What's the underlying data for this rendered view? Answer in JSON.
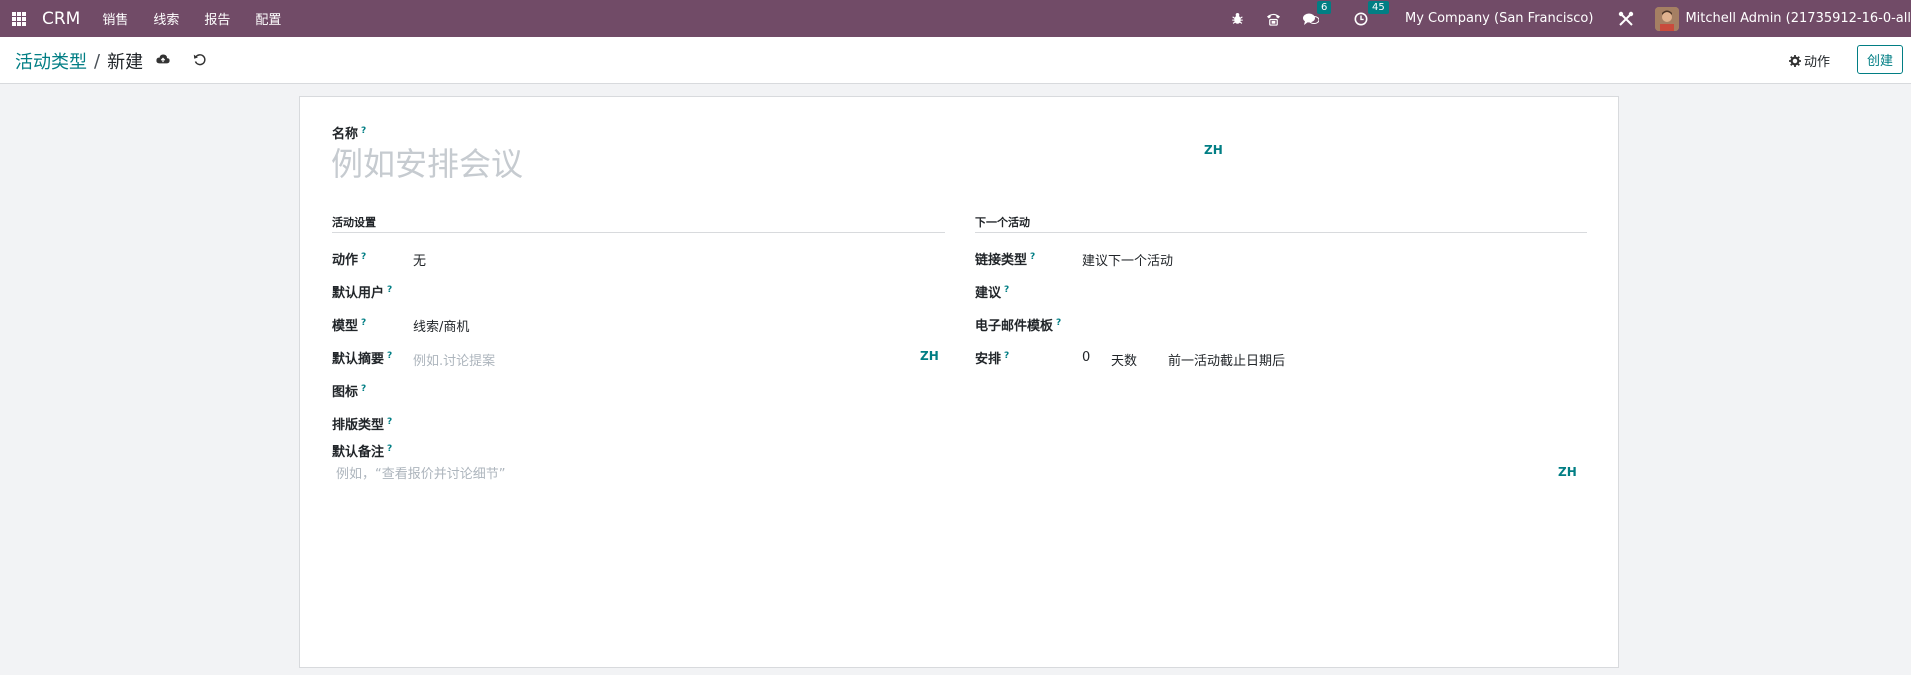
{
  "navbar": {
    "brand": "CRM",
    "menu": [
      "销售",
      "线索",
      "报告",
      "配置"
    ],
    "chat_count": "6",
    "activity_count": "45",
    "company": "My Company (San Francisco)",
    "user": "Mitchell Admin (21735912-16-0-all"
  },
  "control_panel": {
    "breadcrumb_parent": "活动类型",
    "breadcrumb_separator": "/",
    "breadcrumb_current": "新建",
    "action_label": "动作",
    "create_label": "创建"
  },
  "form": {
    "name_label": "名称",
    "name_placeholder": "例如安排会议",
    "lang_code": "ZH",
    "left_section_title": "活动设置",
    "right_section_title": "下一个活动",
    "action": {
      "label": "动作",
      "value": "无"
    },
    "default_user": {
      "label": "默认用户",
      "value": ""
    },
    "model": {
      "label": "模型",
      "value": "线索/商机"
    },
    "default_summary": {
      "label": "默认摘要",
      "placeholder": "例如.讨论提案"
    },
    "icon": {
      "label": "图标",
      "value": ""
    },
    "decoration_type": {
      "label": "排版类型",
      "value": ""
    },
    "default_note": {
      "label": "默认备注",
      "placeholder": "例如，“查看报价并讨论细节”"
    },
    "chaining_type": {
      "label": "链接类型",
      "value": "建议下一个活动"
    },
    "suggest": {
      "label": "建议",
      "value": ""
    },
    "email_templates": {
      "label": "电子邮件模板",
      "value": ""
    },
    "schedule": {
      "label": "安排",
      "delay_count": "0",
      "delay_unit": "天数",
      "delay_from": "前一活动截止日期后"
    },
    "help_mark": "?"
  },
  "colors": {
    "navbar": "#714b67",
    "accent": "#017e84"
  },
  "icons": [
    "apps-grid-icon",
    "bug-icon",
    "phone-icon",
    "chat-icon",
    "clock-icon",
    "tools-icon",
    "cloud-upload-icon",
    "undo-icon",
    "gear-icon"
  ]
}
